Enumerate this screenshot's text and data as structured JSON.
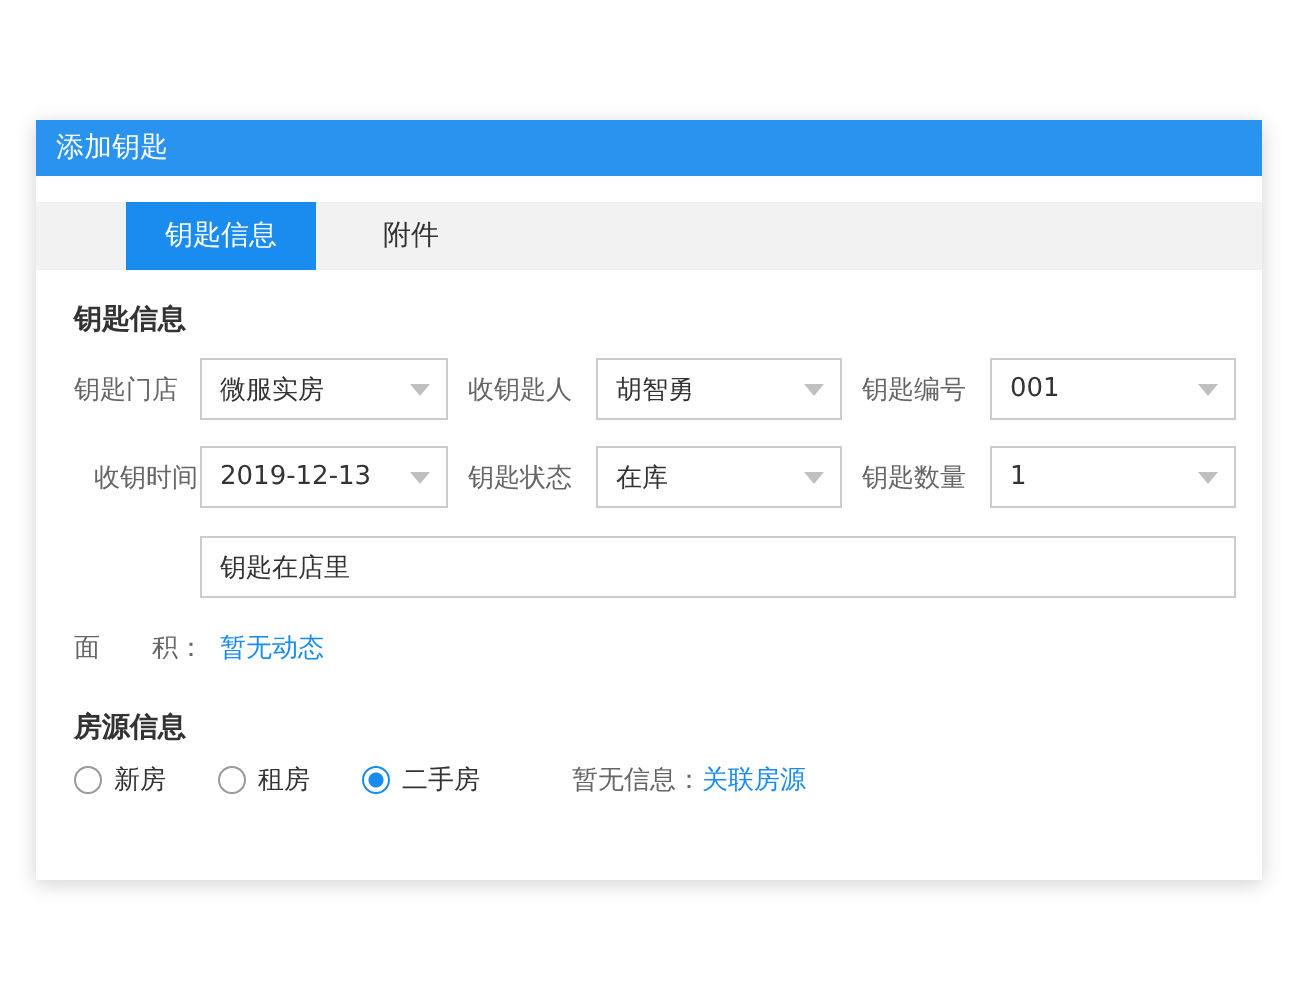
{
  "dialog": {
    "title": "添加钥匙"
  },
  "tabs": [
    {
      "label": "钥匙信息",
      "selected": true
    },
    {
      "label": "附件",
      "selected": false
    }
  ],
  "key_section": {
    "heading": "钥匙信息",
    "fields": [
      {
        "label": "钥匙门店",
        "value": "微服实房"
      },
      {
        "label": "收钥匙人",
        "value": "胡智勇"
      },
      {
        "label": "钥匙编号",
        "value": "001"
      },
      {
        "label": "收钥时间",
        "value": "2019-12-13"
      },
      {
        "label": "钥匙状态",
        "value": "在库"
      },
      {
        "label": "钥匙数量",
        "value": "1"
      }
    ],
    "note": {
      "value": "钥匙在店里"
    },
    "area": {
      "label": "面　　积：",
      "value": "暂无动态"
    }
  },
  "property_section": {
    "heading": "房源信息",
    "options": [
      {
        "label": "新房",
        "selected": false
      },
      {
        "label": "租房",
        "selected": false
      },
      {
        "label": "二手房",
        "selected": true
      }
    ],
    "info_label": "暂无信息：",
    "link": "关联房源"
  }
}
